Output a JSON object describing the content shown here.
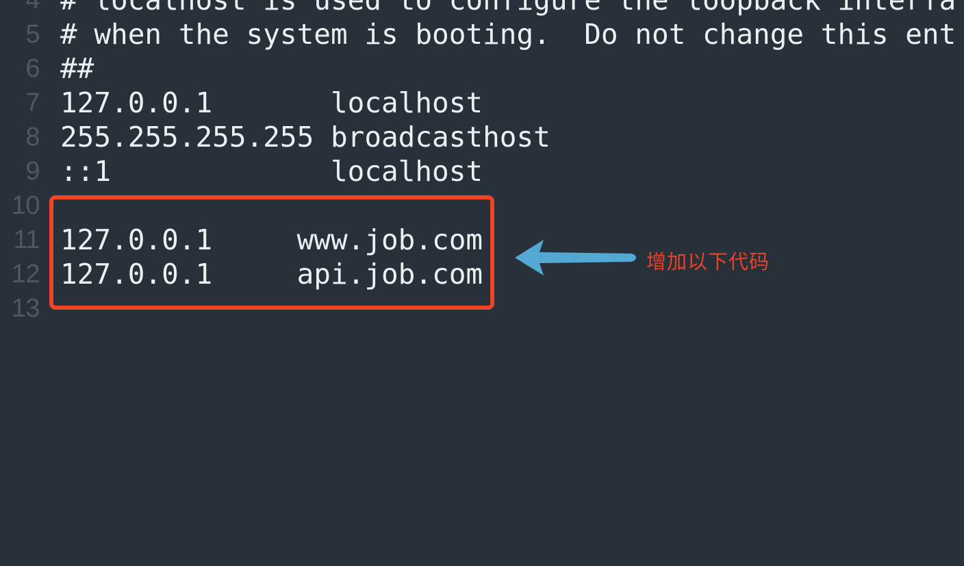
{
  "editor": {
    "background_color": "#283139",
    "text_color": "#e9f2f2",
    "gutter_color": "#4b5963",
    "first_visible_line": 4,
    "last_visible_line": 13,
    "lines": [
      {
        "number": "4",
        "text": "# localhost is used to configure the loopback interfa",
        "clipped_top": true
      },
      {
        "number": "5",
        "text": "# when the system is booting.  Do not change this ent"
      },
      {
        "number": "6",
        "text": "##"
      },
      {
        "number": "7",
        "text": "127.0.0.1       localhost"
      },
      {
        "number": "8",
        "text": "255.255.255.255 broadcasthost"
      },
      {
        "number": "9",
        "text": "::1             localhost"
      },
      {
        "number": "10",
        "text": ""
      },
      {
        "number": "11",
        "text": "127.0.0.1     www.job.com"
      },
      {
        "number": "12",
        "text": "127.0.0.1     api.job.com"
      },
      {
        "number": "13",
        "text": ""
      }
    ]
  },
  "annotations": {
    "highlight_box": {
      "color": "#ef4524",
      "covers_lines": "10-13",
      "border_width_px": 6
    },
    "arrow": {
      "color": "#54a8d4",
      "direction": "left"
    },
    "note": {
      "text": "增加以下代码",
      "color": "#e8412a"
    }
  }
}
